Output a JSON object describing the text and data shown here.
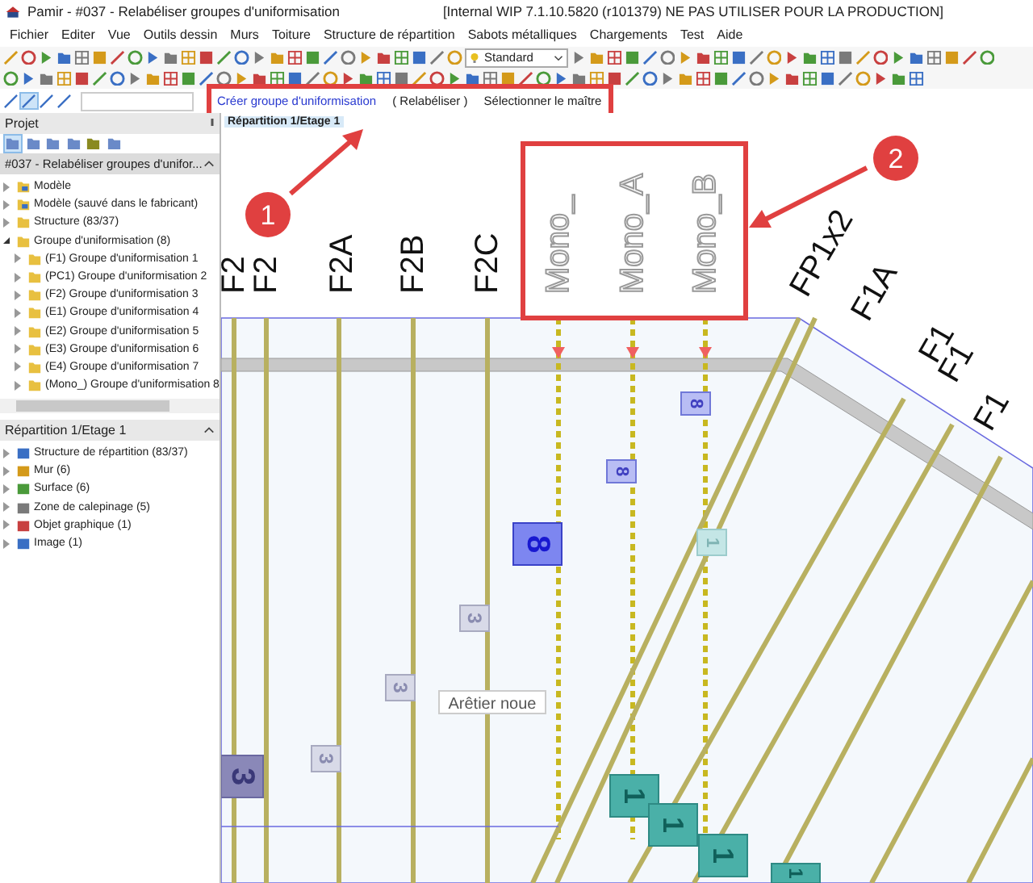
{
  "window": {
    "title": "Pamir - #037 - Relabéliser groupes d'uniformisation",
    "build_note": "[Internal WIP 7.1.10.5820 (r101379) NE PAS UTILISER POUR LA PRODUCTION]"
  },
  "menu": [
    "Fichier",
    "Editer",
    "Vue",
    "Outils dessin",
    "Murs",
    "Toiture",
    "Structure de répartition",
    "Sabots métalliques",
    "Chargements",
    "Test",
    "Aide"
  ],
  "toolbar": {
    "style_select": "Standard"
  },
  "command_bar": [
    {
      "label": "Créer groupe d'uniformisation",
      "kind": "link"
    },
    {
      "label": "( Relabéliser )",
      "kind": "button"
    },
    {
      "label": "Sélectionner le maître",
      "kind": "button"
    }
  ],
  "project_panel": {
    "title": "Projet",
    "header": "#037 - Relabéliser groupes d'unifor...",
    "tree": [
      {
        "label": "Modèle",
        "expanded": false
      },
      {
        "label": "Modèle (sauvé dans le fabricant)",
        "expanded": false
      },
      {
        "label": "Structure (83/37)",
        "expanded": false
      },
      {
        "label": "Groupe d'uniformisation (8)",
        "expanded": true,
        "children": [
          {
            "label": "(F1) Groupe d'uniformisation 1",
            "expanded": false
          },
          {
            "label": "(PC1) Groupe d'uniformisation 2",
            "expanded": false
          },
          {
            "label": "(F2) Groupe d'uniformisation 3",
            "expanded": false
          },
          {
            "label": "(E1) Groupe d'uniformisation 4",
            "expanded": false
          },
          {
            "label": "(E2) Groupe d'uniformisation 5",
            "expanded": false
          },
          {
            "label": "(E3) Groupe d'uniformisation 6",
            "expanded": false
          },
          {
            "label": "(E4) Groupe d'uniformisation 7",
            "expanded": false
          },
          {
            "label": "(Mono_) Groupe d'uniformisation 8",
            "expanded": false
          }
        ]
      }
    ]
  },
  "distribution_panel": {
    "title": "Répartition 1/Etage 1",
    "tree": [
      {
        "label": "Structure de répartition (83/37)",
        "expanded": false
      },
      {
        "label": "Mur (6)",
        "expanded": false
      },
      {
        "label": "Surface (6)",
        "expanded": false
      },
      {
        "label": "Zone de calepinage (5)",
        "expanded": false
      },
      {
        "label": "Objet graphique (1)",
        "expanded": false
      },
      {
        "label": "Image (1)",
        "expanded": false
      }
    ]
  },
  "canvas": {
    "tab": "Répartition 1/Etage 1",
    "member_labels": [
      {
        "text": "F2",
        "kind": "plain"
      },
      {
        "text": "F2",
        "kind": "plain"
      },
      {
        "text": "F2A",
        "kind": "plain"
      },
      {
        "text": "F2B",
        "kind": "plain"
      },
      {
        "text": "F2C",
        "kind": "plain"
      },
      {
        "text": "Mono_",
        "kind": "ghost"
      },
      {
        "text": "Mono_A",
        "kind": "ghost"
      },
      {
        "text": "Mono_B",
        "kind": "ghost"
      },
      {
        "text": "FP1x2",
        "kind": "diagonal"
      },
      {
        "text": "F1A",
        "kind": "diagonal"
      },
      {
        "text": "F1",
        "kind": "diagonal"
      },
      {
        "text": "F1",
        "kind": "diagonal"
      },
      {
        "text": "F1",
        "kind": "diagonal"
      }
    ],
    "tags": [
      {
        "text": "8",
        "kind": "selected"
      },
      {
        "text": "8",
        "kind": "normal"
      },
      {
        "text": "8",
        "kind": "normal"
      },
      {
        "text": "3",
        "kind": "faint"
      },
      {
        "text": "3",
        "kind": "faint"
      },
      {
        "text": "3",
        "kind": "faint"
      },
      {
        "text": "3",
        "kind": "dark"
      },
      {
        "text": "1",
        "kind": "teal-faint"
      },
      {
        "text": "1",
        "kind": "teal"
      },
      {
        "text": "1",
        "kind": "teal"
      },
      {
        "text": "1",
        "kind": "teal"
      },
      {
        "text": "1",
        "kind": "teal"
      }
    ],
    "note": "Arêtier noue"
  },
  "callouts": [
    "1",
    "2"
  ]
}
